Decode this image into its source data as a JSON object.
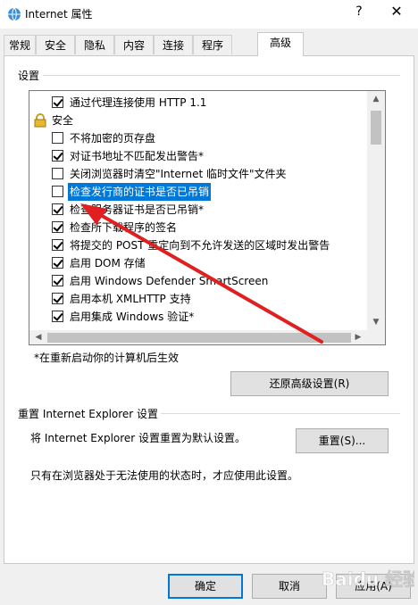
{
  "window": {
    "title": "Internet 属性",
    "help_label": "?",
    "close_label": "✕"
  },
  "tabs": [
    {
      "label": "常规"
    },
    {
      "label": "安全"
    },
    {
      "label": "隐私"
    },
    {
      "label": "内容"
    },
    {
      "label": "连接"
    },
    {
      "label": "程序"
    },
    {
      "label": "高级"
    }
  ],
  "active_tab": "高级",
  "settings": {
    "group_label": "设置",
    "items": [
      {
        "label": "通过代理连接使用 HTTP 1.1",
        "checked": true
      },
      {
        "label": "安全",
        "section": true
      },
      {
        "label": "不将加密的页存盘",
        "checked": false
      },
      {
        "label": "对证书地址不匹配发出警告*",
        "checked": true
      },
      {
        "label": "关闭浏览器时清空\"Internet 临时文件\"文件夹",
        "checked": false
      },
      {
        "label": "检查发行商的证书是否已吊销",
        "checked": false,
        "selected": true
      },
      {
        "label": "检查服务器证书是否已吊销*",
        "checked": true
      },
      {
        "label": "检查所下载程序的签名",
        "checked": true
      },
      {
        "label": "将提交的 POST 重定向到不允许发送的区域时发出警告",
        "checked": true
      },
      {
        "label": "启用 DOM 存储",
        "checked": true
      },
      {
        "label": "启用 Windows Defender SmartScreen",
        "checked": true
      },
      {
        "label": "启用本机 XMLHTTP 支持",
        "checked": true
      },
      {
        "label": "启用集成 Windows 验证*",
        "checked": true
      }
    ],
    "restart_note": "*在重新启动你的计算机后生效",
    "restore_button": "还原高级设置(R)"
  },
  "reset": {
    "group_label": "重置 Internet Explorer 设置",
    "description": "将 Internet Explorer 设置重置为默认设置。",
    "reset_button": "重置(S)...",
    "note": "只有在浏览器处于无法使用的状态时，才应使用此设置。"
  },
  "footer": {
    "ok": "确定",
    "cancel": "取消",
    "apply": "应用(A)"
  },
  "watermark": {
    "text": "Baidu 经验"
  },
  "colors": {
    "selection": "#0078d7",
    "annotation_arrow": "#e02020"
  }
}
